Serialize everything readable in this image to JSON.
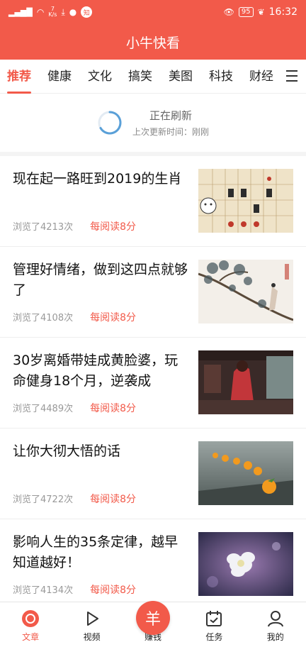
{
  "status_bar": {
    "signal": "⁴⁶",
    "speed_value": "7",
    "speed_unit": "K/s",
    "notif_badge": "知",
    "battery": "95",
    "time": "16:32"
  },
  "app": {
    "title": "小牛快看"
  },
  "tabs": [
    {
      "label": "推荐",
      "active": true
    },
    {
      "label": "健康"
    },
    {
      "label": "文化"
    },
    {
      "label": "搞笑"
    },
    {
      "label": "美图"
    },
    {
      "label": "科技"
    },
    {
      "label": "财经"
    }
  ],
  "refresh": {
    "status": "正在刷新",
    "last_update": "上次更新时间：刚刚"
  },
  "articles": [
    {
      "title": "现在起一路旺到2019的生肖",
      "views": "浏览了4213次",
      "reward": "每阅读8分",
      "thumb": "zodiac-chart-image"
    },
    {
      "title": "管理好情绪，做到这四点就够了",
      "views": "浏览了4108次",
      "reward": "每阅读8分",
      "thumb": "ink-painting-image"
    },
    {
      "title": "30岁离婚带娃成黄脸婆，玩命健身18个月，逆袭成",
      "views": "浏览了4489次",
      "reward": "每阅读8分",
      "thumb": "woman-red-dress-image"
    },
    {
      "title": "让你大彻大悟的话",
      "views": "浏览了4722次",
      "reward": "每阅读8分",
      "thumb": "oranges-image"
    },
    {
      "title": "影响人生的35条定律，越早知道越好！",
      "views": "浏览了4134次",
      "reward": "每阅读8分",
      "thumb": "white-flower-image"
    }
  ],
  "bottom_nav": [
    {
      "label": "文章",
      "icon": "article-icon",
      "active": true
    },
    {
      "label": "视频",
      "icon": "play-icon"
    },
    {
      "label": "赚钱",
      "icon": "coin-icon",
      "coin_glyph": "羊"
    },
    {
      "label": "任务",
      "icon": "calendar-icon"
    },
    {
      "label": "我的",
      "icon": "user-icon"
    }
  ],
  "colors": {
    "accent": "#f25a4a"
  }
}
